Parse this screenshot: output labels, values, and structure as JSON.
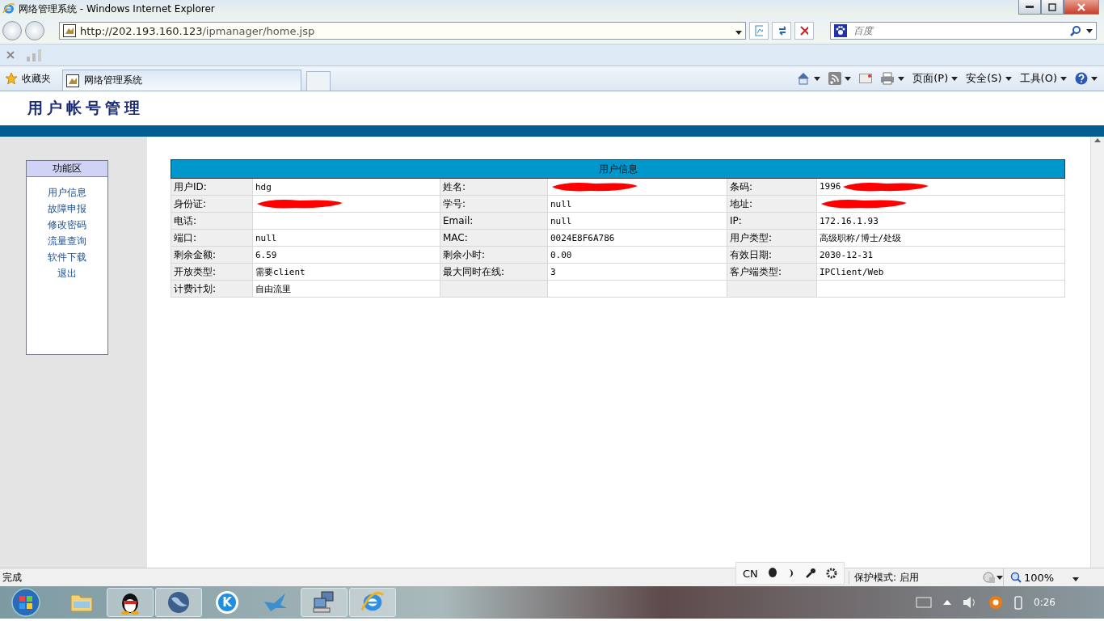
{
  "window": {
    "title": "网络管理系统 - Windows Internet Explorer"
  },
  "address": {
    "url_host": "http://202.193.160.123",
    "url_path": "/ipmanager/home.jsp"
  },
  "search": {
    "placeholder": "百度"
  },
  "favorites": {
    "label": "收藏夹"
  },
  "tabs": [
    {
      "label": "网络管理系统",
      "selected": true
    }
  ],
  "commands": [
    {
      "kind": "home"
    },
    {
      "kind": "feed"
    },
    {
      "kind": "mail"
    },
    {
      "kind": "print"
    },
    {
      "kind": "menu",
      "label": "页面(P)"
    },
    {
      "kind": "menu",
      "label": "安全(S)"
    },
    {
      "kind": "menu",
      "label": "工具(O)"
    },
    {
      "kind": "help"
    }
  ],
  "page": {
    "title": "用户帐号管理"
  },
  "menu": {
    "heading": "功能区",
    "items": [
      "用户信息",
      "故障申报",
      "修改密码",
      "流量查询",
      "软件下载",
      "退出"
    ]
  },
  "table": {
    "title": "用户信息",
    "rows": [
      [
        {
          "label": "用户ID:",
          "value": "hdg"
        },
        {
          "label": "姓名:",
          "redacted": true
        },
        {
          "label": "条码:",
          "value": "1996",
          "redacted": true
        }
      ],
      [
        {
          "label": "身份证:",
          "redacted": true
        },
        {
          "label": "学号:",
          "value": "null"
        },
        {
          "label": "地址:",
          "redacted": true
        }
      ],
      [
        {
          "label": "电话:"
        },
        {
          "label": "Email:",
          "value": "null"
        },
        {
          "label": "IP:",
          "value": "172.16.1.93"
        }
      ],
      [
        {
          "label": "端口:",
          "value": "null"
        },
        {
          "label": "MAC:",
          "value": "0024E8F6A786"
        },
        {
          "label": "用户类型:",
          "value": "高级职称/博士/处级"
        }
      ],
      [
        {
          "label": "剩余金额:",
          "value": "6.59"
        },
        {
          "label": "剩余小时:",
          "value": "0.00"
        },
        {
          "label": "有效日期:",
          "value": "2030-12-31"
        }
      ],
      [
        {
          "label": "开放类型:",
          "value": "需要client"
        },
        {
          "label": "最大同时在线:",
          "value": "3"
        },
        {
          "label": "客户端类型:",
          "value": "IPClient/Web"
        }
      ],
      [
        {
          "label": "计费计划:",
          "value": "自由流里"
        },
        {},
        {}
      ]
    ]
  },
  "status": {
    "text": "完成",
    "protected_mode": "保护模式: 启用",
    "zoom": "100%"
  },
  "language_bar": {
    "code": "CN"
  },
  "taskbar": {
    "items": [
      {
        "kind": "folder",
        "open": false
      },
      {
        "kind": "penguin",
        "open": true
      },
      {
        "kind": "globe",
        "open": true
      },
      {
        "kind": "k",
        "glyph": "K",
        "open": false
      },
      {
        "kind": "bird",
        "open": false
      },
      {
        "kind": "network",
        "open": true
      },
      {
        "kind": "ie",
        "open": true
      }
    ],
    "clock": "0:26"
  }
}
